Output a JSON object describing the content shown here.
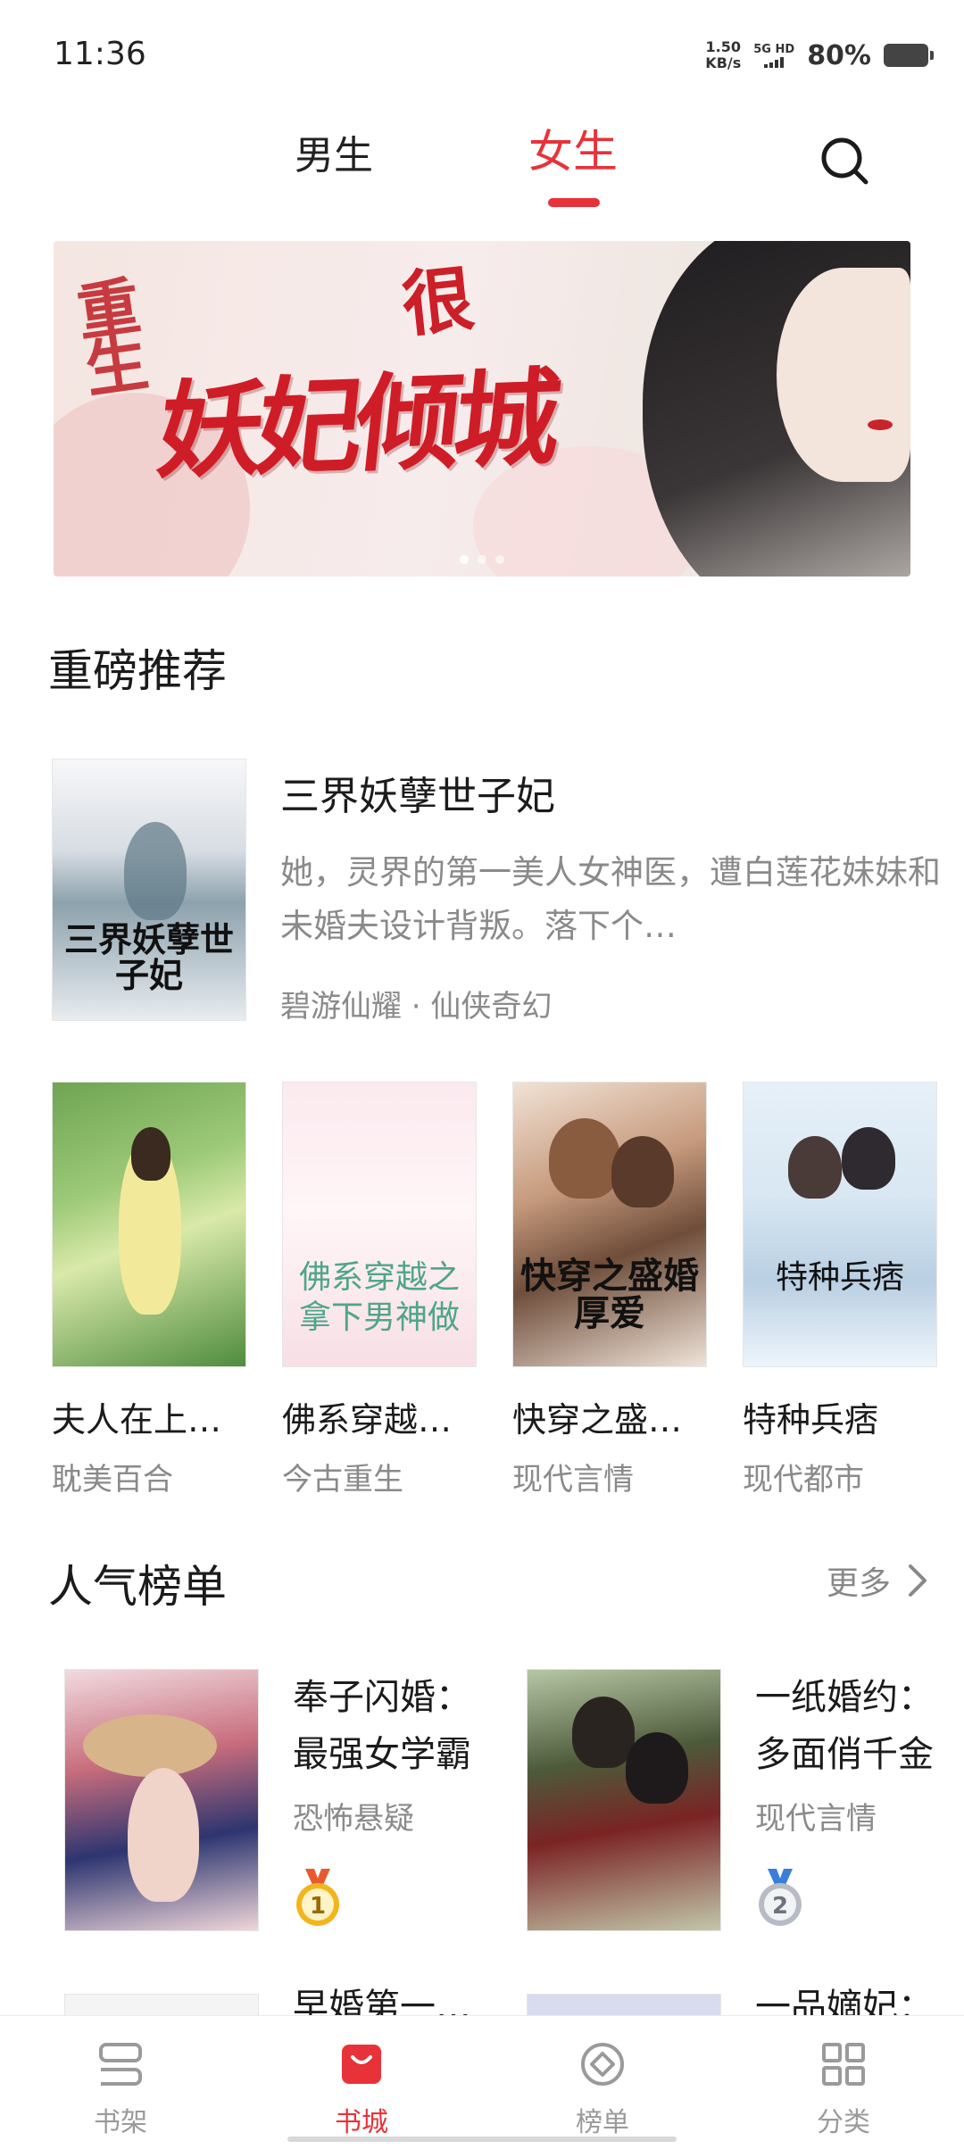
{
  "status_bar": {
    "time": "11:36",
    "net_speed_value": "1.50",
    "net_speed_unit": "KB/s",
    "network_type": "5G HD",
    "battery": "80%"
  },
  "top_tabs": {
    "boys": "男生",
    "girls": "女生",
    "active": "女生",
    "accent_color": "#e8323a"
  },
  "banner": {
    "title": "妖妃倾城",
    "subtitle_1": "重生",
    "subtitle_2": "很",
    "slide_count": 3,
    "active_slide": 1
  },
  "featured_section": {
    "title": "重磅推荐",
    "book": {
      "title": "三界妖孽世子妃",
      "cover_text": "三界妖孽世子妃",
      "description": "她，灵界的第一美人女神医，遭白莲花妹妹和未婚夫设计背叛。落下个…",
      "meta": "碧游仙耀 · 仙侠奇幻"
    },
    "grid": [
      {
        "title": "夫人在上…",
        "genre": "耽美百合",
        "cover_text": ""
      },
      {
        "title": "佛系穿越…",
        "genre": "今古重生",
        "cover_text": "佛系穿越之拿下男神做"
      },
      {
        "title": "快穿之盛…",
        "genre": "现代言情",
        "cover_text": "快穿之盛婚厚爱"
      },
      {
        "title": "特种兵痞",
        "genre": "现代都市",
        "cover_text": "特种兵痞"
      }
    ]
  },
  "ranking_section": {
    "title": "人气榜单",
    "more": "更多",
    "items": [
      {
        "title": "奉子闪婚：最强女学霸",
        "genre": "恐怖悬疑",
        "rank": "1",
        "medal_color": "#f2b51e"
      },
      {
        "title": "一纸婚约：多面俏千金",
        "genre": "现代言情",
        "rank": "2",
        "medal_color": "#b7bcc4"
      }
    ],
    "partial_row": [
      "早婚第一…",
      "一品嫡妃："
    ]
  },
  "bottom_nav": {
    "items": [
      {
        "label": "书架",
        "icon": "bookshelf-icon"
      },
      {
        "label": "书城",
        "icon": "bookstore-icon"
      },
      {
        "label": "榜单",
        "icon": "ranking-icon"
      },
      {
        "label": "分类",
        "icon": "category-icon"
      }
    ],
    "active": "书城"
  }
}
